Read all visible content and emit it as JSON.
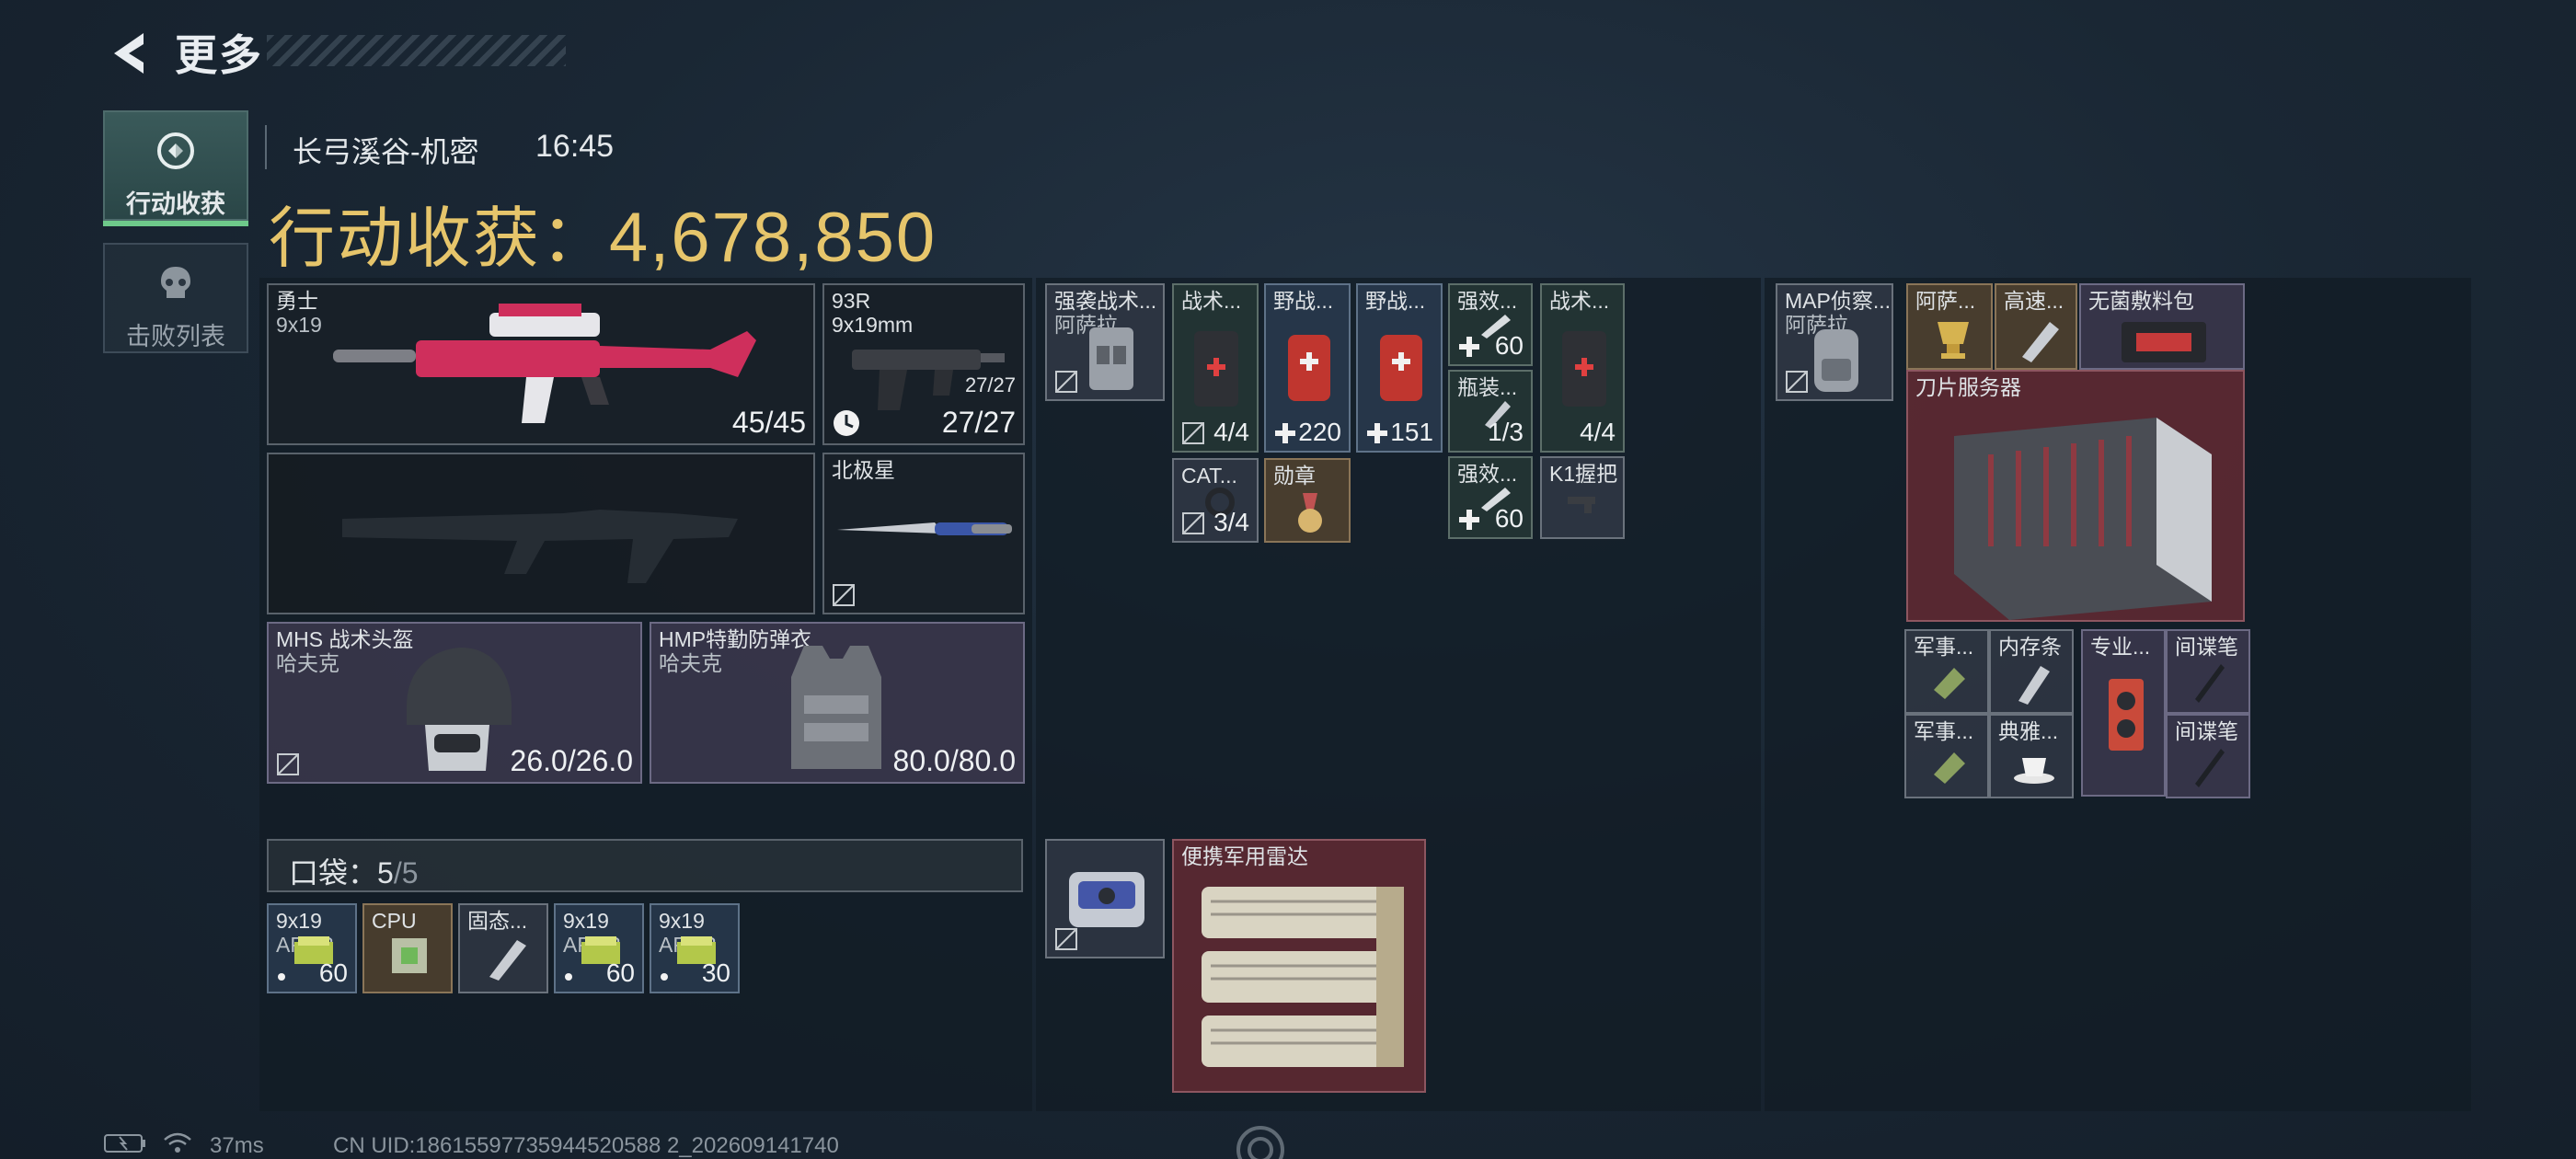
{
  "header": {
    "title": "更多"
  },
  "tabs": [
    {
      "label": "行动收获",
      "active": true
    },
    {
      "label": "击败列表",
      "active": false
    }
  ],
  "map": {
    "name": "长弓溪谷-机密",
    "time": "16:45"
  },
  "earnings": {
    "label": "行动收获：",
    "value": "4,678,850"
  },
  "loadout": {
    "primary": {
      "name": "勇士",
      "ammo_type": "9x19",
      "ammo": "45/45"
    },
    "secondary": {
      "name": "93R",
      "ammo_type": "9x19mm",
      "ammo_small": "27/27",
      "ammo": "27/27"
    },
    "melee": {
      "name": "北极星"
    },
    "helmet": {
      "name": "MHS 战术头盔",
      "brand": "哈夫克",
      "durability": "26.0/26.0"
    },
    "armor": {
      "name": "HMP特勤防弹衣",
      "brand": "哈夫克",
      "durability": "80.0/80.0"
    }
  },
  "pocket": {
    "label": "口袋：",
    "used": "5",
    "sep": "/",
    "total": "5",
    "items": [
      {
        "name": "9x19",
        "sub": "AP6.3",
        "count": "60"
      },
      {
        "name": "CPU",
        "sub": "",
        "count": ""
      },
      {
        "name": "固态...",
        "sub": "",
        "count": ""
      },
      {
        "name": "9x19",
        "sub": "AP6.3",
        "count": "60"
      },
      {
        "name": "9x19",
        "sub": "AP6.3",
        "count": "30"
      }
    ]
  },
  "rig": {
    "chest": {
      "name": "强袭战术...",
      "brand": "阿萨拉"
    },
    "items": [
      {
        "name": "战术...",
        "count": "4/4"
      },
      {
        "name": "野战...",
        "count": "220"
      },
      {
        "name": "野战...",
        "count": "151"
      },
      {
        "name": "强效...",
        "count": "60"
      },
      {
        "name": "战术...",
        "count": "4/4"
      },
      {
        "name": "瓶装...",
        "count": "1/3"
      },
      {
        "name": "CAT...",
        "count": "3/4"
      },
      {
        "name": "勋章",
        "count": ""
      },
      {
        "name": "强效...",
        "count": "60"
      },
      {
        "name": "K1握把",
        "count": ""
      }
    ]
  },
  "backpack_bottom": {
    "name": "便携军用雷达"
  },
  "backpack": {
    "bag": {
      "name": "MAP侦察...",
      "brand": "阿萨拉"
    },
    "items": [
      {
        "name": "阿萨..."
      },
      {
        "name": "高速..."
      },
      {
        "name": "无菌敷料包"
      },
      {
        "name": "刀片服务器"
      },
      {
        "name": "军事..."
      },
      {
        "name": "内存条"
      },
      {
        "name": "专业..."
      },
      {
        "name": "间谍笔"
      },
      {
        "name": "军事..."
      },
      {
        "name": "典雅..."
      },
      {
        "name": "间谍笔"
      }
    ]
  },
  "status": {
    "ping": "37ms",
    "uid": "CN UID:18615597735944520588 2_202609141740"
  },
  "colors": {
    "accent_gold": "#e6c56b",
    "tab_active_bar": "#6ec98a"
  }
}
